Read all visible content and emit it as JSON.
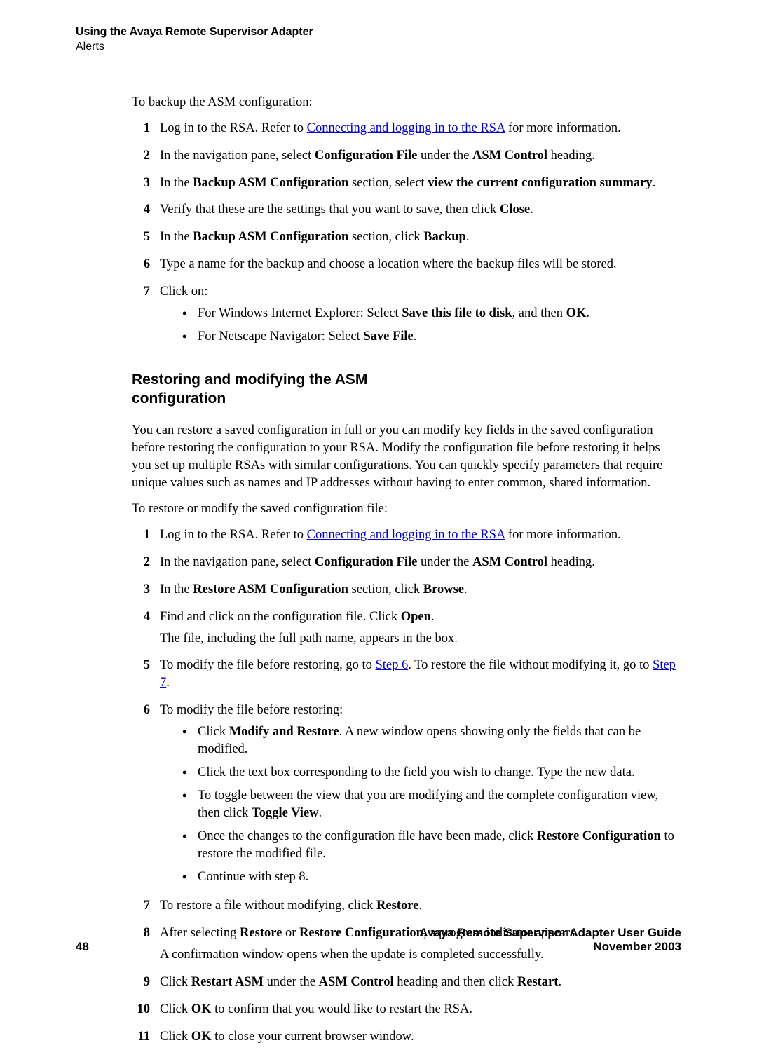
{
  "header": {
    "title": "Using the Avaya Remote Supervisor Adapter",
    "subtitle": "Alerts"
  },
  "section1": {
    "intro": "To backup the ASM configuration:",
    "steps": {
      "s1_a": "Log in to the RSA. Refer to ",
      "s1_link": "Connecting and logging in to the RSA",
      "s1_b": " for more information.",
      "s2_a": "In the navigation pane, select ",
      "s2_b1": "Configuration File",
      "s2_c": " under the ",
      "s2_b2": "ASM Control",
      "s2_d": " heading.",
      "s3_a": "In the ",
      "s3_b1": "Backup ASM Configuration",
      "s3_c": " section, select ",
      "s3_b2": "view the current configuration summary",
      "s3_d": ".",
      "s4_a": "Verify that these are the settings that you want to save, then click ",
      "s4_b": "Close",
      "s4_c": ".",
      "s5_a": "In the ",
      "s5_b1": "Backup ASM Configuration",
      "s5_c": " section, click ",
      "s5_b2": "Backup",
      "s5_d": ".",
      "s6": "Type a name for the backup and choose a location where the backup files will be stored.",
      "s7": "Click on:",
      "s7_b1_a": "For Windows Internet Explorer: Select ",
      "s7_b1_b": "Save this file to disk",
      "s7_b1_c": ", and then ",
      "s7_b1_d": "OK",
      "s7_b1_e": ".",
      "s7_b2_a": "For Netscape Navigator: Select ",
      "s7_b2_b": "Save File",
      "s7_b2_c": "."
    }
  },
  "section2": {
    "heading_l1": "Restoring and modifying the ASM",
    "heading_l2": "configuration",
    "para1": "You can restore a saved configuration in full or you can modify key fields in the saved configuration before restoring the configuration to your RSA. Modify the configuration file before restoring it helps you set up multiple RSAs with similar configurations. You can quickly specify parameters that require unique values such as names and IP addresses without having to enter common, shared information.",
    "intro": "To restore or modify the saved configuration file:",
    "steps": {
      "s1_a": "Log in to the RSA. Refer to ",
      "s1_link": "Connecting and logging in to the RSA",
      "s1_b": " for more information.",
      "s2_a": "In the navigation pane, select ",
      "s2_b1": "Configuration File",
      "s2_c": " under the ",
      "s2_b2": "ASM Control",
      "s2_d": " heading.",
      "s3_a": "In the ",
      "s3_b1": "Restore ASM Configuration",
      "s3_c": " section, click ",
      "s3_b2": "Browse",
      "s3_d": ".",
      "s4_a": "Find and click on the configuration file. Click ",
      "s4_b": "Open",
      "s4_c": ".",
      "s4_p2": "The file, including the full path name, appears in the box.",
      "s5_a": "To modify the file before restoring, go to ",
      "s5_link1": "Step 6",
      "s5_b": ". To restore the file without modifying it, go to ",
      "s5_link2": "Step 7",
      "s5_c": ".",
      "s6": "To modify the file before restoring:",
      "s6_b1_a": "Click ",
      "s6_b1_b": "Modify and Restore",
      "s6_b1_c": ". A new window opens showing only the fields that can be modified.",
      "s6_b2": "Click the text box corresponding to the field you wish to change. Type the new data.",
      "s6_b3_a": "To toggle between the view that you are modifying and the complete configuration view, then click ",
      "s6_b3_b": "Toggle View",
      "s6_b3_c": ".",
      "s6_b4_a": "Once the changes to the configuration file have been made, click ",
      "s6_b4_b": "Restore Configuration",
      "s6_b4_c": " to restore the modified file.",
      "s6_b5": "Continue with step 8.",
      "s7_a": "To restore a file without modifying, click ",
      "s7_b": "Restore",
      "s7_c": ".",
      "s8_a": "After selecting ",
      "s8_b1": "Restore",
      "s8_c": " or ",
      "s8_b2": "Restore Configuration",
      "s8_d": ", a progress indicator appears.",
      "s8_p2": "A confirmation window opens when the update is completed successfully.",
      "s9_a": "Click ",
      "s9_b1": "Restart ASM",
      "s9_c": " under the ",
      "s9_b2": "ASM Control",
      "s9_d": " heading and then click ",
      "s9_b3": "Restart",
      "s9_e": ".",
      "s10_a": "Click ",
      "s10_b": "OK",
      "s10_c": " to confirm that you would like to restart the RSA.",
      "s11_a": "Click ",
      "s11_b": "OK",
      "s11_c": " to close your current browser window."
    }
  },
  "nums": {
    "n1": "1",
    "n2": "2",
    "n3": "3",
    "n4": "4",
    "n5": "5",
    "n6": "6",
    "n7": "7",
    "n8": "8",
    "n9": "9",
    "n10": "10",
    "n11": "11"
  },
  "footer": {
    "page": "48",
    "line1": "Avaya Remote Supervisor Adapter User Guide",
    "line2": "November 2003"
  }
}
